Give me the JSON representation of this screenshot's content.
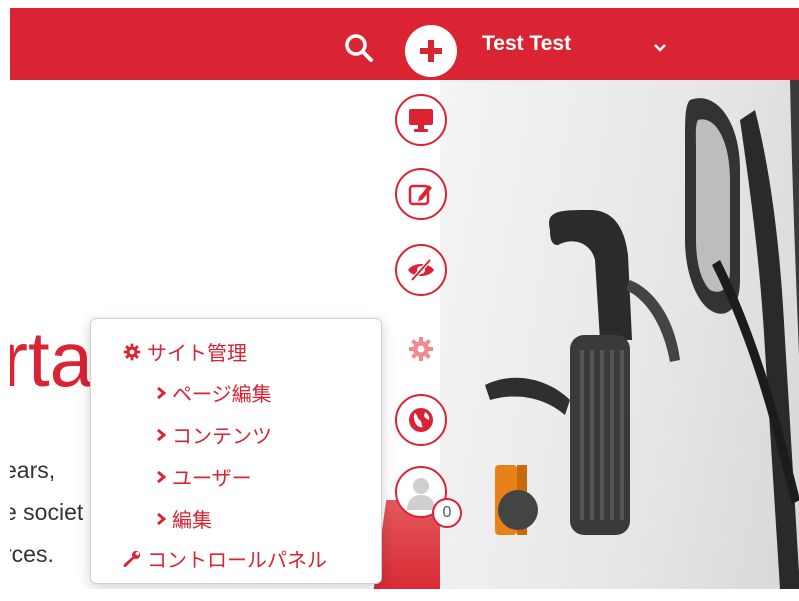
{
  "header": {
    "user_name": "Test Test",
    "icons": {
      "search": "search-icon",
      "add": "plus-icon",
      "caret": "chevron-down-icon"
    }
  },
  "toolbar": {
    "items": [
      {
        "name": "monitor",
        "icon": "monitor-icon"
      },
      {
        "name": "edit",
        "icon": "edit-icon"
      },
      {
        "name": "preview",
        "icon": "eye-slash-icon"
      },
      {
        "name": "settings",
        "icon": "gear-icon"
      },
      {
        "name": "globe",
        "icon": "globe-icon"
      },
      {
        "name": "user",
        "icon": "avatar-icon"
      }
    ],
    "notification_count": "0"
  },
  "hero": {
    "title_fragment": "rta",
    "text_lines": [
      "ears,",
      "e societ",
      "rces."
    ]
  },
  "menu": {
    "site_admin": "サイト管理",
    "sub_items": [
      "ページ編集",
      "コンテンツ",
      "ユーザー",
      "編集"
    ],
    "control_panel": "コントロールパネル"
  },
  "colors": {
    "accent": "#da2333"
  }
}
